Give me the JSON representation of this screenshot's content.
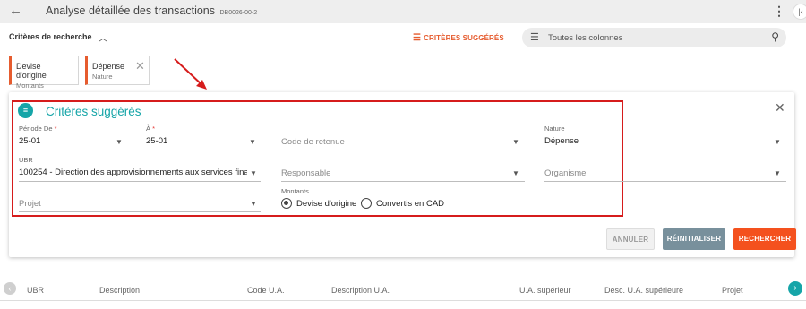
{
  "header": {
    "title": "Analyse détaillée des transactions",
    "code": "DB0026-00-2",
    "back_icon": "arrow-left-icon",
    "menu_icon": "kebab-menu-icon"
  },
  "criteria_bar": {
    "toggle_label": "Critères de recherche",
    "suggest_label": "CRITÈRES SUGGÉRÉS",
    "search_placeholder": "Toutes les colonnes"
  },
  "chips": [
    {
      "value": "Devise d'origine",
      "category": "Montants"
    },
    {
      "value": "Dépense",
      "category": "Nature"
    }
  ],
  "panel": {
    "title": "Critères suggérés",
    "fields": {
      "periode_de": {
        "label": "Période De",
        "required": "*",
        "value": "25-01"
      },
      "periode_a": {
        "label": "À",
        "required": "*",
        "value": "25-01"
      },
      "code_retenue": {
        "placeholder": "Code de retenue"
      },
      "nature": {
        "label": "Nature",
        "value": "Dépense"
      },
      "ubr": {
        "label": "UBR",
        "value": "100254 - Direction des approvisionnements aux services finan..."
      },
      "responsable": {
        "placeholder": "Responsable"
      },
      "organisme": {
        "placeholder": "Organisme"
      },
      "projet": {
        "placeholder": "Projet"
      }
    },
    "montants": {
      "label": "Montants",
      "options": [
        "Devise d'origine",
        "Convertis en CAD"
      ],
      "selected": "Devise d'origine"
    },
    "buttons": {
      "cancel": "ANNULER",
      "reset": "RÉINITIALISER",
      "search": "RECHERCHER"
    }
  },
  "table": {
    "columns": [
      "UBR",
      "Description",
      "Code U.A.",
      "Description U.A.",
      "U.A. supérieur",
      "Desc. U.A. supérieure",
      "Projet"
    ]
  },
  "colors": {
    "accent_teal": "#16a5a8",
    "accent_orange": "#f4511e",
    "highlight_red": "#d61c1c"
  }
}
